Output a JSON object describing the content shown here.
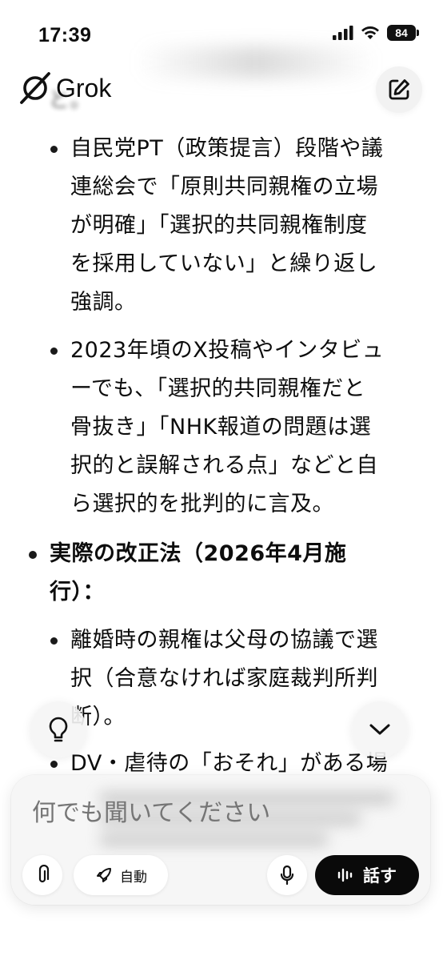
{
  "status_bar": {
    "time": "17:39",
    "battery": "84"
  },
  "header": {
    "app_name": "Grok"
  },
  "content": {
    "top_fragment": "と。",
    "sub1_lines": [
      "自民党PT（政策提言）段階や議",
      "連総会で「原則共同親権の立場",
      "が明確」「選択的共同親権制度",
      "を採用していない」と繰り返し",
      "強調。"
    ],
    "sub2_lines": [
      "2023年頃のX投稿やインタビュ",
      "ーでも、「選択的共同親権だと",
      "骨抜き」「NHK報道の問題は選",
      "択的と誤解される点」などと自",
      "ら選択的を批判的に言及。"
    ],
    "main_lines": [
      "実際の改正法（2026年4月施",
      "行）："
    ],
    "sub3_lines": [
      "離婚時の親権は父母の協議で選",
      "択（合意なければ家庭裁判所判",
      "断）。"
    ],
    "sub4_line": "DV・虐待の「おそれ」がある場"
  },
  "composer": {
    "placeholder": "何でも聞いてください",
    "auto_label": "自動",
    "talk_label": "話す"
  }
}
